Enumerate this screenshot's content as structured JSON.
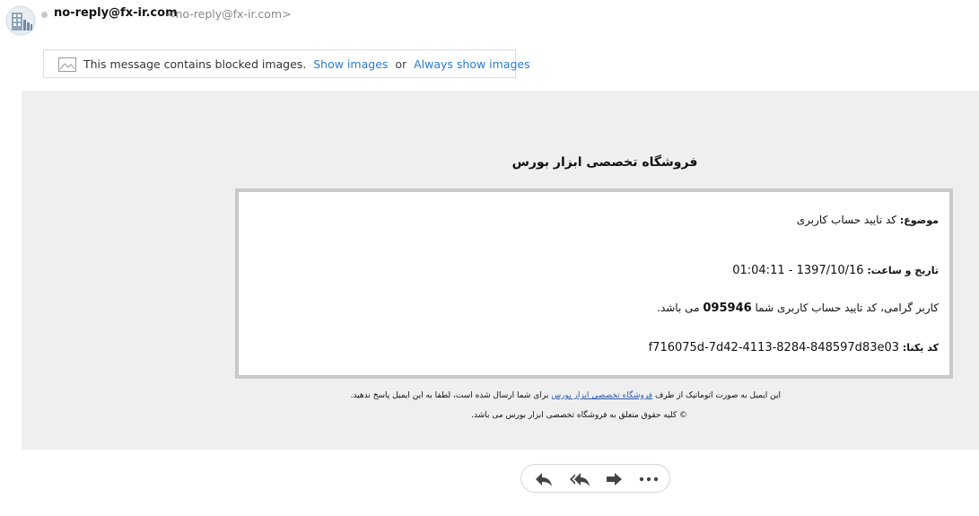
{
  "header": {
    "sender_name": "no-reply@fx-ir.com",
    "sender_email": "<no-reply@fx-ir.com>",
    "status_color": "#c8c8c8"
  },
  "blocked_banner": {
    "message": "This message contains blocked images.",
    "show_images": "Show images",
    "or": "or",
    "always_show": "Always show images",
    "link_color": "#2a7ad3"
  },
  "email": {
    "store_title": "فروشگاه تخصصی ابزار بورس",
    "subject_label": "موضوع:",
    "subject_value": "کد تایید حساب کاربری",
    "datetime_label": "تاریخ و ساعت:",
    "datetime_value": "1397/10/16 - 01:04:11",
    "message_before": "کاربر گرامی، کد تایید حساب کاربری شما",
    "code": "095946",
    "message_after": "می باشد.",
    "unique_label": "کد یکتا:",
    "unique_value": "f716075d-7d42-4113-8284-848597d83e03",
    "footer_before": "این ایمیل به صورت اتوماتیک از طرف",
    "footer_link": "فروشگاه تخصصی ابزار بورس",
    "footer_after": "برای شما ارسال شده است، لطفا به این ایمیل پاسخ ندهید.",
    "copyright": "© کلیه حقوق متعلق به فروشگاه تخصصی ابزار بورس می باشد.",
    "background": "#efefef"
  },
  "actions": {
    "icons": [
      "reply-icon",
      "reply-all-icon",
      "forward-icon",
      "more-icon"
    ]
  }
}
